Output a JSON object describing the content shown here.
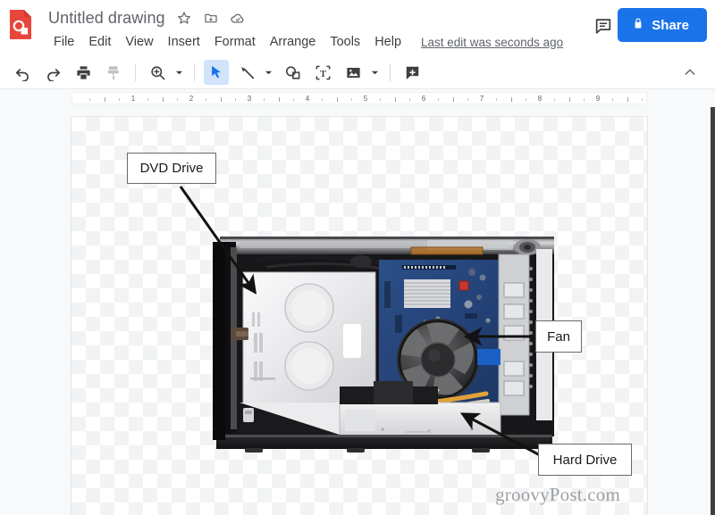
{
  "app": {
    "logo_icon": "google-drawings-logo",
    "doc_title": "Untitled drawing",
    "title_icons": [
      {
        "name": "star-icon",
        "label": "Star"
      },
      {
        "name": "move-to-folder-icon",
        "label": "Move to folder"
      },
      {
        "name": "cloud-saved-icon",
        "label": "Saved to Drive"
      }
    ]
  },
  "menu": {
    "items": [
      {
        "label": "File"
      },
      {
        "label": "Edit"
      },
      {
        "label": "View"
      },
      {
        "label": "Insert"
      },
      {
        "label": "Format"
      },
      {
        "label": "Arrange"
      },
      {
        "label": "Tools"
      },
      {
        "label": "Help"
      }
    ],
    "last_edit": "Last edit was seconds ago"
  },
  "header_actions": {
    "comment_icon": "comment-icon",
    "share_label": "Share",
    "share_icon": "lock-icon",
    "share_color": "#1a73e8"
  },
  "toolbar": {
    "items": [
      {
        "name": "undo-button",
        "icon": "undo-icon",
        "state": "enabled"
      },
      {
        "name": "redo-button",
        "icon": "redo-icon",
        "state": "enabled"
      },
      {
        "name": "print-button",
        "icon": "print-icon",
        "state": "enabled"
      },
      {
        "name": "paint-format-button",
        "icon": "paint-format-icon",
        "state": "disabled"
      },
      {
        "name": "zoom-button",
        "icon": "zoom-icon",
        "state": "enabled"
      },
      {
        "name": "select-button",
        "icon": "cursor-arrow-icon",
        "state": "active"
      },
      {
        "name": "line-button",
        "icon": "line-icon",
        "state": "enabled"
      },
      {
        "name": "shape-button",
        "icon": "shape-icon",
        "state": "enabled"
      },
      {
        "name": "text-box-button",
        "icon": "text-box-icon",
        "state": "enabled"
      },
      {
        "name": "image-button",
        "icon": "image-icon",
        "state": "enabled"
      },
      {
        "name": "comment-button",
        "icon": "add-comment-icon",
        "state": "enabled"
      }
    ],
    "collapse_icon": "chevron-up-icon",
    "active_color": "#d2e3fc"
  },
  "ruler": {
    "unit_numbers": [
      1,
      2,
      3,
      4,
      5,
      6,
      7,
      8,
      9
    ]
  },
  "canvas": {
    "background": "transparent-checkerboard",
    "image_alt": "desktop-computer-interior-photo",
    "callouts": [
      {
        "name": "callout-dvd-drive",
        "label": "DVD Drive"
      },
      {
        "name": "callout-fan",
        "label": "Fan"
      },
      {
        "name": "callout-hard-drive",
        "label": "Hard Drive"
      }
    ],
    "watermark": "groovyPost.com"
  }
}
